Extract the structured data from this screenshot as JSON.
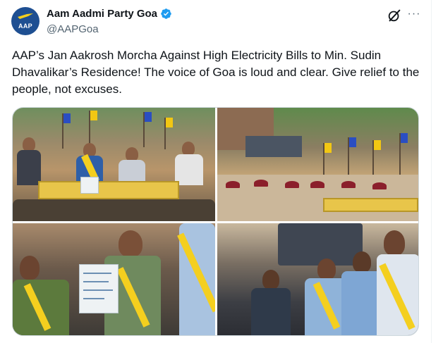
{
  "account": {
    "display_name": "Aam Aadmi Party Goa",
    "handle": "@AAPGoa",
    "avatar_text": "AAP",
    "verified": true
  },
  "actions": {
    "grok_icon": "grok-icon",
    "more_icon": "more-icon",
    "more_label": "···"
  },
  "tweet": {
    "text": "AAP’s Jan Aakrosh Morcha Against High Electricity Bills to Min. Sudin Dhavalikar’s Residence! The voice of Goa is loud and clear. Give relief to the people, not excuses."
  },
  "media": {
    "photo_count": 4
  },
  "colors": {
    "verified_blue": "#1d9bf0",
    "avatar_blue": "#1e4f92",
    "aap_yellow": "#f4cf1f",
    "text": "#0f1419",
    "secondary_text": "#536471",
    "border": "#cfd9de"
  }
}
